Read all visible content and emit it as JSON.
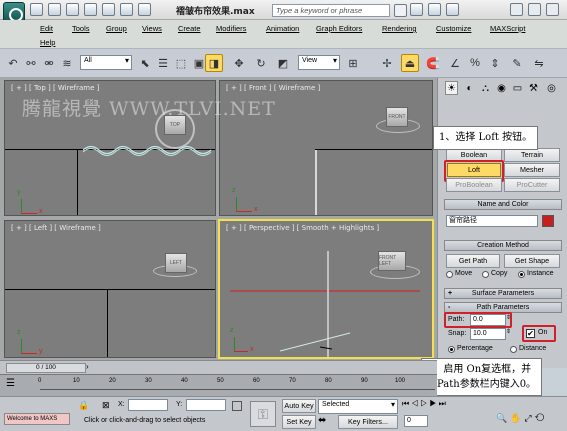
{
  "window": {
    "title": "褶皱布帘效果.max",
    "search_placeholder": "Type a keyword or phrase"
  },
  "menu": [
    "Edit",
    "Tools",
    "Group",
    "Views",
    "Create",
    "Modifiers",
    "Animation",
    "Graph Editors",
    "Rendering",
    "Customize",
    "MAXScript",
    "Help"
  ],
  "toolbar": {
    "filter": "All",
    "coord": "View"
  },
  "viewports": {
    "top": {
      "label": "[ + ] [ Top ] [ Wireframe ]",
      "cube": "TOP"
    },
    "front": {
      "label": "[ + ] [ Front ] [ Wireframe ]",
      "cube": "FRONT"
    },
    "left": {
      "label": "[ + ] [ Left ] [ Wireframe ]",
      "cube": "LEFT"
    },
    "perspective": {
      "label": "[ + ] [ Perspective ] [ Smooth + Highlights ]",
      "cube": "FRONT LEFT"
    },
    "axis_x": "x",
    "axis_y": "y",
    "axis_z": "z"
  },
  "watermark": "腾龍視覺 WWW.TLVI.NET",
  "command_panel": {
    "row1": [
      "Boolean",
      "Terrain"
    ],
    "row2": [
      "Loft",
      "Mesher"
    ],
    "row3": [
      "ProBoolean",
      "ProCutter"
    ],
    "name_color_title": "Name and Color",
    "object_name": "窗帘路径",
    "object_color": "#c81e1e",
    "creation_method_title": "Creation Method",
    "get_path": "Get Path",
    "get_shape": "Get Shape",
    "move": "Move",
    "copy": "Copy",
    "instance": "Instance",
    "surface_params": "Surface Parameters",
    "path_params": "Path Parameters",
    "path_label": "Path:",
    "path_value": "0.0",
    "snap_label": "Snap:",
    "snap_value": "10.0",
    "on_label": "On",
    "on_checked": true,
    "percentage": "Percentage",
    "distance": "Distance",
    "pm_plus": "+",
    "pm_minus": "-"
  },
  "callouts": {
    "one": "1、选择 Loft 按钮。",
    "two_line1": "2、启用 On复选框，并",
    "two_line2": "在Path参数栏内键入0。"
  },
  "timeline": {
    "frame": "0 / 100"
  },
  "track_ticks": [
    "0",
    "10",
    "20",
    "30",
    "40",
    "50",
    "60",
    "70",
    "80",
    "90",
    "100"
  ],
  "status": {
    "maxscript": "Welcome to MAXS",
    "coord_x": "X:",
    "coord_y": "Y:",
    "prompt": "Click or click-and-drag to select objects",
    "auto_key": "Auto Key",
    "selected": "Selected",
    "set_key": "Set Key",
    "key_filters": "Key Filters...",
    "frame_field": "0"
  }
}
